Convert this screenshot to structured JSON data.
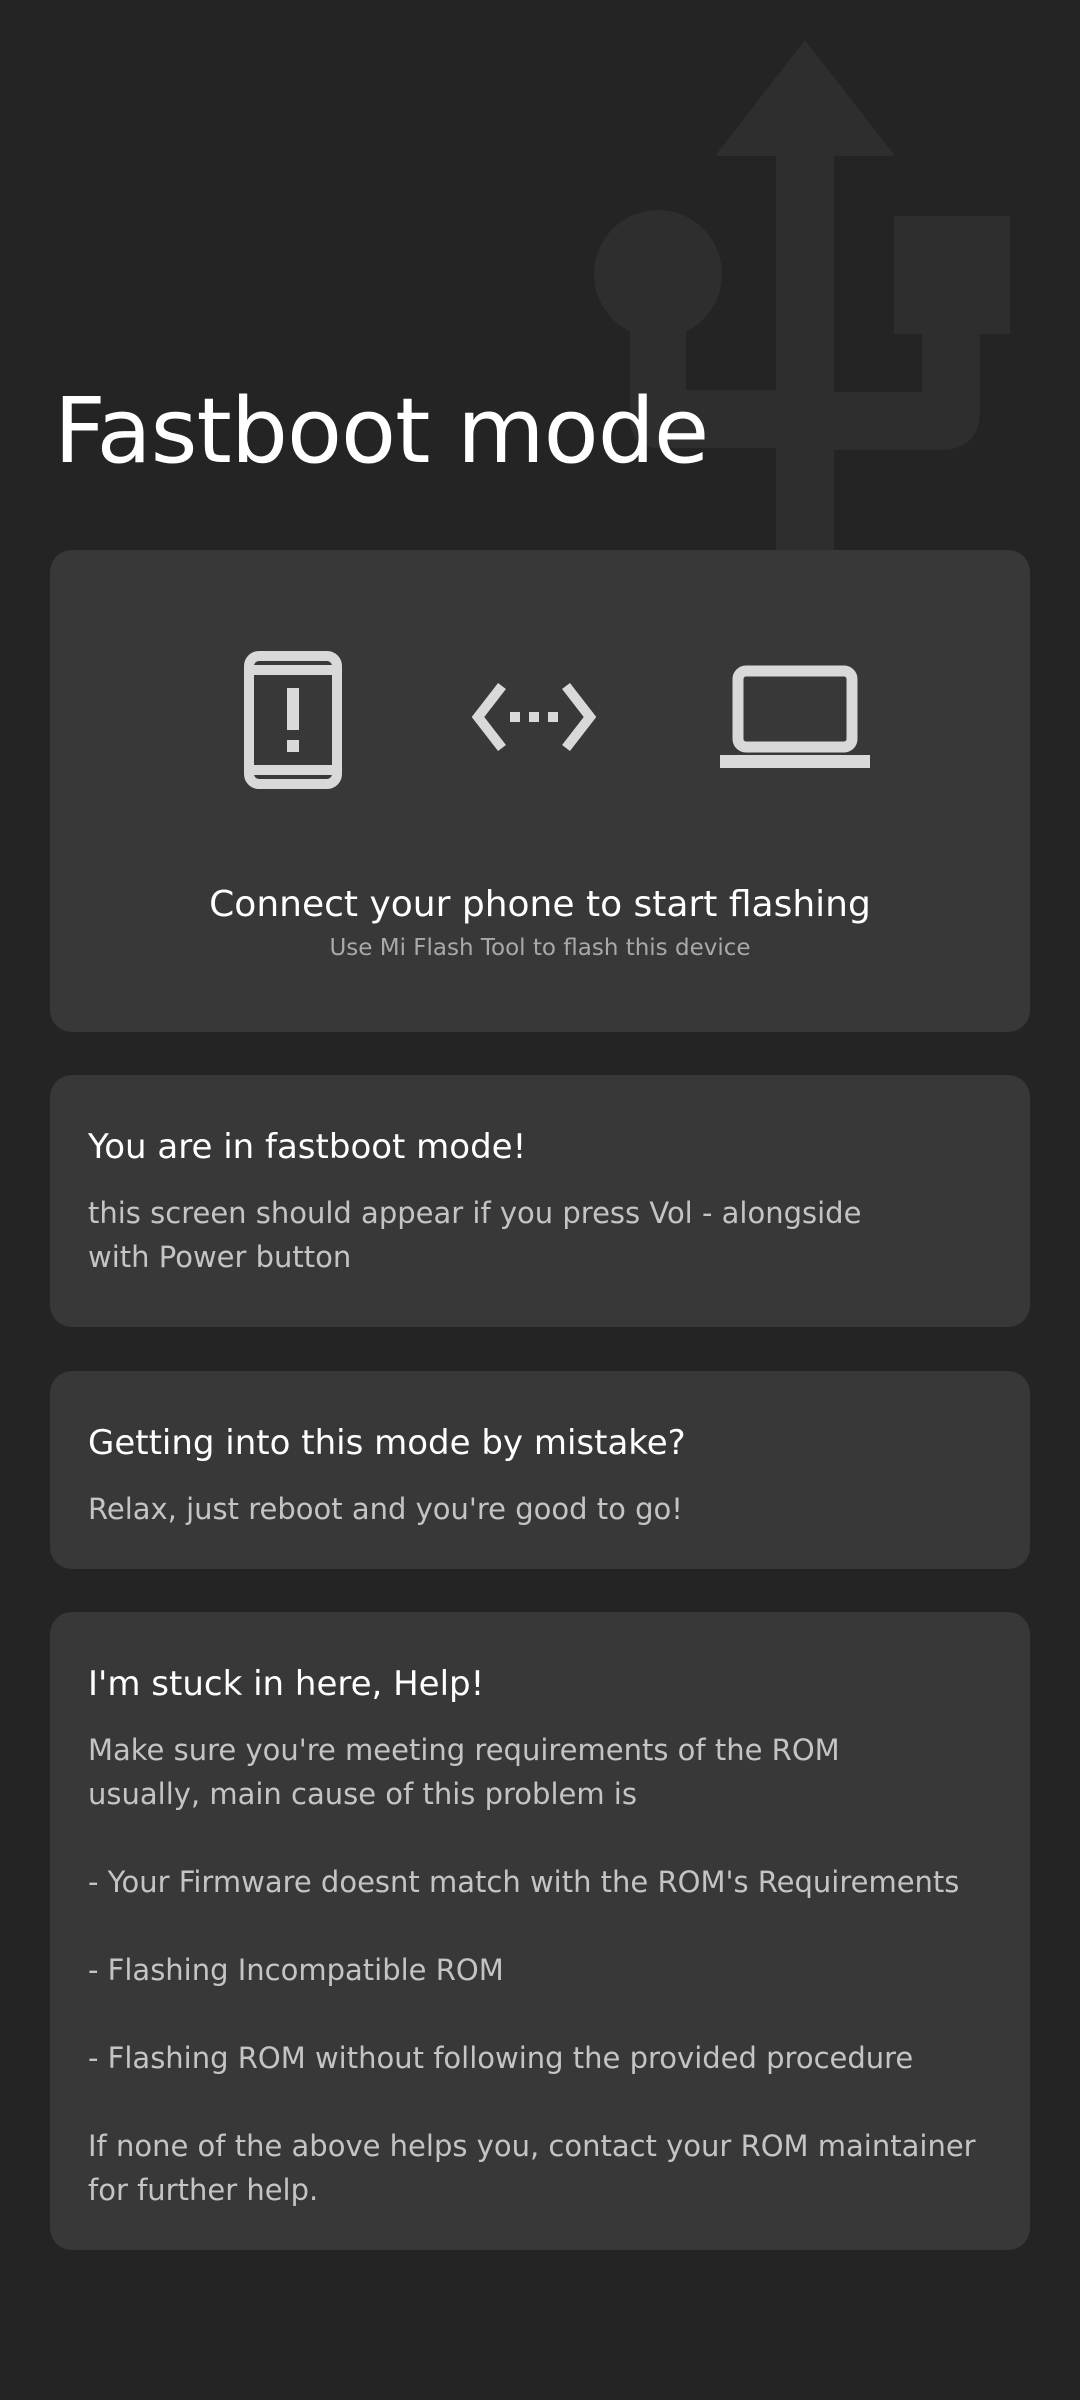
{
  "page": {
    "title": "Fastboot mode"
  },
  "connect_card": {
    "title": "Connect your phone to start flashing",
    "subtitle": "Use Mi Flash Tool to flash this device",
    "icons": [
      "phone-alert-icon",
      "transfer-arrows-icon",
      "laptop-icon"
    ]
  },
  "info_card": {
    "heading": "You are in fastboot mode!",
    "body": "this screen should appear if you press Vol - alongside\nwith Power button"
  },
  "mistake_card": {
    "heading": "Getting into this mode by mistake?",
    "body": "Relax, just reboot and you're good to go!"
  },
  "stuck_card": {
    "heading": "I'm stuck in here, Help!",
    "body": "Make sure you're meeting requirements of the ROM\nusually, main cause of this problem is\n\n- Your Firmware doesnt match with the ROM's Requirements\n\n- Flashing Incompatible ROM\n\n- Flashing ROM without following the provided procedure\n\nIf none of the above helps you, contact your ROM maintainer\nfor further help."
  },
  "colors": {
    "background": "#242424",
    "card": "#383838",
    "usb_watermark": "#2e2e2e",
    "icon": "#d9d9d9",
    "muted_text": "#a9a9a9",
    "body_text": "#c4c4c4"
  }
}
